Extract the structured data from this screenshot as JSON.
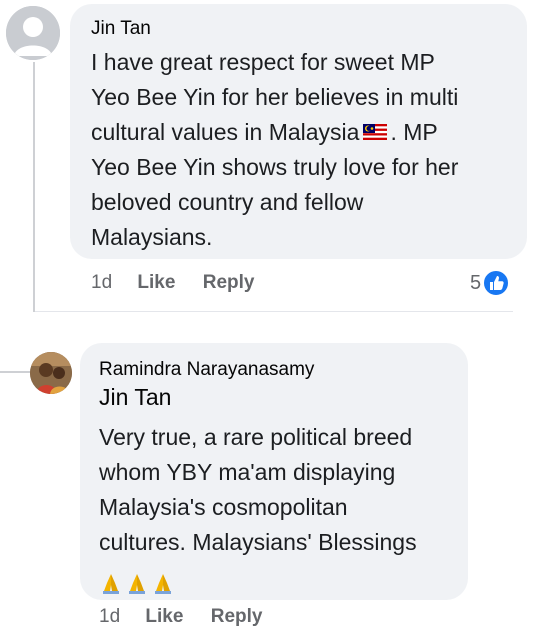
{
  "comments": [
    {
      "author": "Jin Tan",
      "text_lines": [
        "I have great respect for sweet MP",
        "Yeo Bee Yin for her believes in multi",
        "cultural values in Malaysia",
        ". MP",
        "Yeo Bee Yin shows truly love for her",
        "beloved country and fellow",
        "Malaysians."
      ],
      "time": "1d",
      "like_label": "Like",
      "reply_label": "Reply",
      "reaction_count": "5",
      "reaction_icon": "like-icon",
      "inline_emoji": "malaysia-flag-icon"
    },
    {
      "author": "Ramindra Narayanasamy",
      "mention": "Jin Tan",
      "text_lines": [
        "Very true, a rare political breed",
        "whom YBY ma'am displaying",
        "Malaysia's cosmopolitan",
        "cultures. Malaysians' Blessings"
      ],
      "emoji": "folded-hands-icon",
      "time": "1d",
      "like_label": "Like",
      "reply_label": "Reply"
    }
  ],
  "colors": {
    "bubble": "#f0f2f5",
    "meta_text": "#65676b",
    "like_blue": "#1877f2"
  }
}
